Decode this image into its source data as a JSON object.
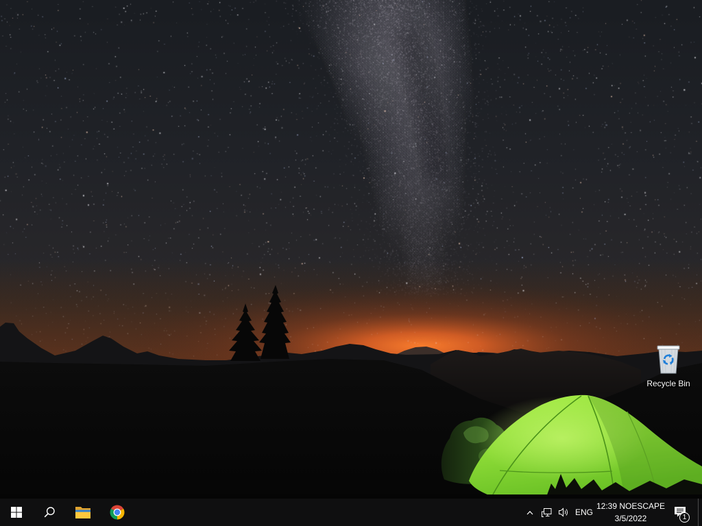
{
  "desktop": {
    "icons": [
      {
        "label": "Recycle Bin",
        "icon": "recycle-bin-icon"
      }
    ]
  },
  "taskbar": {
    "start": {
      "icon": "windows-logo-icon"
    },
    "search": {
      "icon": "search-icon"
    },
    "pinned_apps": [
      {
        "icon": "file-explorer-icon"
      },
      {
        "icon": "chrome-icon"
      }
    ],
    "tray": {
      "overflow_icon": "chevron-up-icon",
      "network_icon": "network-icon",
      "volume_icon": "volume-icon",
      "language": "ENG",
      "time": "12:39 NOESCAPE",
      "date": "3/5/2022",
      "notification_icon": "notification-icon",
      "notification_count": 1
    }
  },
  "colors": {
    "taskbar_background": "#0f0f10",
    "tray_text": "#ffffff",
    "tent_green": "#8fdc3a",
    "horizon_glow": "#e8702c"
  }
}
